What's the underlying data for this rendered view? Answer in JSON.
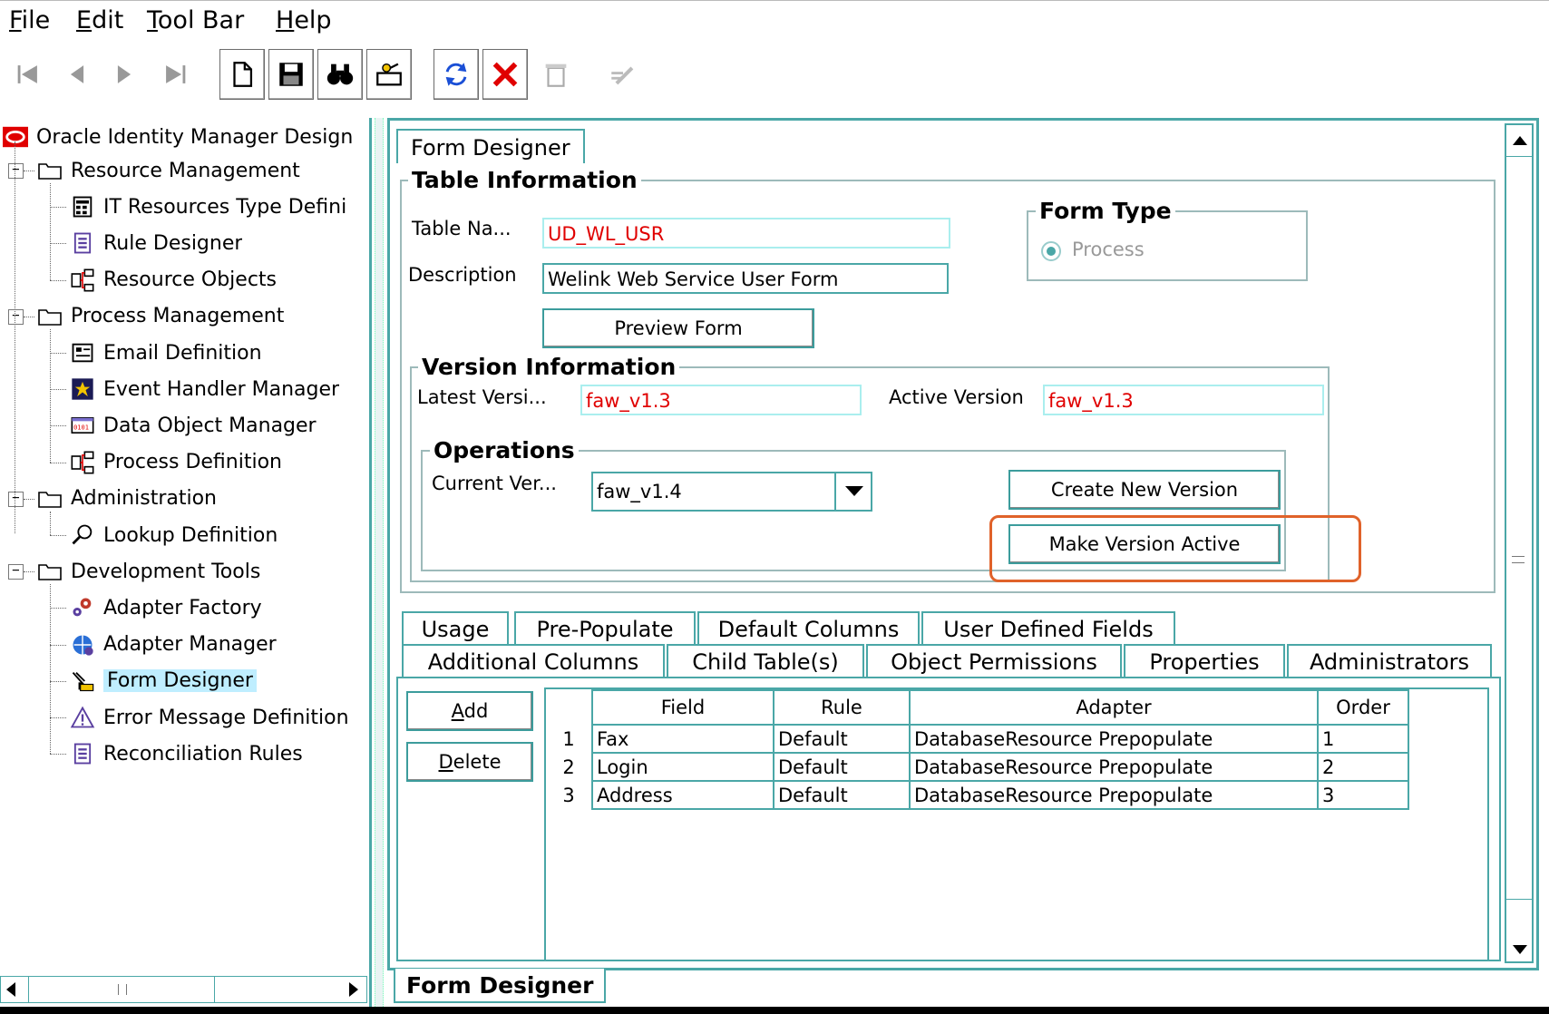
{
  "menu": [
    {
      "key": "file",
      "first": "F",
      "rest": "ile"
    },
    {
      "key": "edit",
      "first": "E",
      "rest": "dit"
    },
    {
      "key": "toolbar",
      "first": "T",
      "rest": "ool Bar"
    },
    {
      "key": "help",
      "first": "H",
      "rest": "elp"
    }
  ],
  "toolbar": {
    "icons": [
      "first-record-icon",
      "previous-record-icon",
      "next-record-icon",
      "last-record-icon",
      "new-document-icon",
      "save-icon",
      "find-binoculars-icon",
      "assign-icon",
      "refresh-icon",
      "delete-x-icon",
      "trash-icon",
      "edit-pen-icon"
    ]
  },
  "tree": {
    "root": "Oracle Identity Manager Design",
    "nodes": [
      {
        "label": "Resource Management",
        "type": "folder"
      },
      {
        "label": "IT Resources Type Defini",
        "type": "leaf",
        "icon": "it-resource-icon"
      },
      {
        "label": "Rule Designer",
        "type": "leaf",
        "icon": "rule-icon"
      },
      {
        "label": "Resource Objects",
        "type": "leaf",
        "icon": "resource-object-icon"
      },
      {
        "label": "Process Management",
        "type": "folder"
      },
      {
        "label": "Email Definition",
        "type": "leaf",
        "icon": "email-icon"
      },
      {
        "label": "Event Handler Manager",
        "type": "leaf",
        "icon": "event-handler-icon"
      },
      {
        "label": "Data Object Manager",
        "type": "leaf",
        "icon": "data-object-icon"
      },
      {
        "label": "Process Definition",
        "type": "leaf",
        "icon": "process-definition-icon"
      },
      {
        "label": "Administration",
        "type": "folder"
      },
      {
        "label": "Lookup Definition",
        "type": "leaf",
        "icon": "lookup-icon"
      },
      {
        "label": "Development Tools",
        "type": "folder"
      },
      {
        "label": "Adapter Factory",
        "type": "leaf",
        "icon": "adapter-factory-icon"
      },
      {
        "label": "Adapter Manager",
        "type": "leaf",
        "icon": "adapter-manager-icon"
      },
      {
        "label": "Form Designer",
        "type": "leaf",
        "icon": "form-designer-icon",
        "selected": true
      },
      {
        "label": "Error Message Definition",
        "type": "leaf",
        "icon": "error-message-icon"
      },
      {
        "label": "Reconciliation Rules",
        "type": "leaf",
        "icon": "reconciliation-icon"
      }
    ]
  },
  "panel": {
    "top_tab": "Form Designer",
    "bottom_tab": "Form Designer",
    "table_info": {
      "legend": "Table Information",
      "table_name_label": "Table Na...",
      "table_name_value": "UD_WL_USR",
      "description_label": "Description",
      "description_value": "Welink Web Service User Form",
      "preview_button": "Preview Form"
    },
    "form_type": {
      "legend": "Form Type",
      "option": "Process"
    },
    "version_info": {
      "legend": "Version Information",
      "latest_label": "Latest Versi...",
      "latest_value": "faw_v1.3",
      "active_label": "Active Version",
      "active_value": "faw_v1.3"
    },
    "operations": {
      "legend": "Operations",
      "current_label": "Current Ver...",
      "current_value": "faw_v1.4",
      "create_button": "Create New Version",
      "make_active_button": "Make Version Active"
    },
    "tabs_row1": [
      "Usage",
      "Pre-Populate",
      "Default Columns",
      "User Defined Fields"
    ],
    "tabs_row2": [
      "Additional Columns",
      "Child Table(s)",
      "Object Permissions",
      "Properties",
      "Administrators"
    ],
    "add_button": {
      "first": "A",
      "rest": "dd"
    },
    "delete_button": {
      "first": "D",
      "rest": "elete"
    },
    "grid": {
      "columns": [
        "Field",
        "Rule",
        "Adapter",
        "Order"
      ],
      "rows": [
        {
          "n": "1",
          "field": "Fax",
          "rule": "Default",
          "adapter": "DatabaseResource Prepopulate",
          "order": "1"
        },
        {
          "n": "2",
          "field": "Login",
          "rule": "Default",
          "adapter": "DatabaseResource Prepopulate",
          "order": "2"
        },
        {
          "n": "3",
          "field": "Address",
          "rule": "Default",
          "adapter": "DatabaseResource Prepopulate",
          "order": "3"
        }
      ]
    }
  }
}
